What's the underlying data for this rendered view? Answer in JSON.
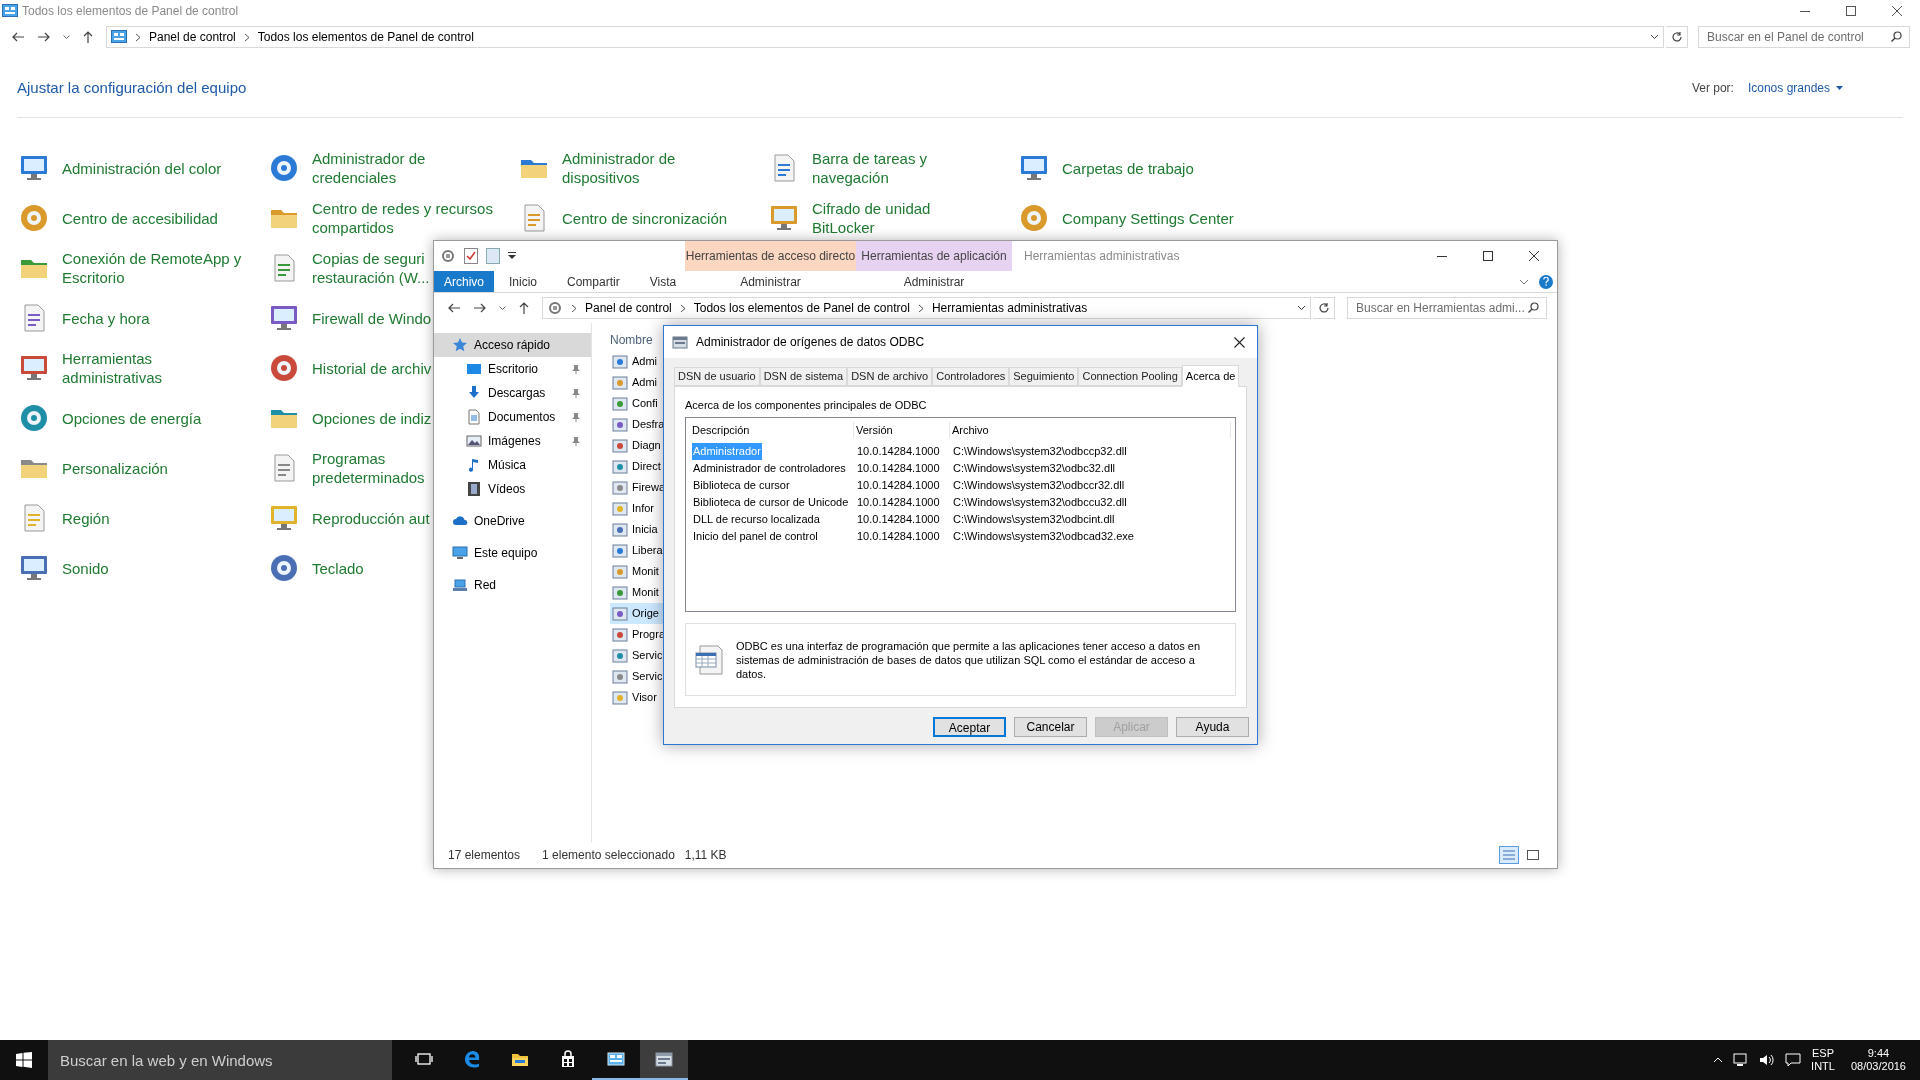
{
  "control_panel": {
    "title": "Todos los elementos de Panel de control",
    "breadcrumb": [
      "Panel de control",
      "Todos los elementos de Panel de control"
    ],
    "search": {
      "placeholder": "Buscar en el Panel de control"
    },
    "heading": "Ajustar la configuración del equipo",
    "view_by": {
      "label": "Ver por:",
      "value": "Iconos grandes"
    },
    "columns": [
      [
        {
          "lines": [
            "Administración del color"
          ]
        },
        {
          "lines": [
            "Centro de accesibilidad"
          ]
        },
        {
          "lines": [
            "Conexión de RemoteApp y",
            "Escritorio"
          ]
        },
        {
          "lines": [
            "Fecha y hora"
          ]
        },
        {
          "lines": [
            "Herramientas",
            "administrativas"
          ]
        },
        {
          "lines": [
            "Opciones de energía"
          ]
        },
        {
          "lines": [
            "Personalización"
          ]
        },
        {
          "lines": [
            "Región"
          ]
        },
        {
          "lines": [
            "Sonido"
          ]
        }
      ],
      [
        {
          "lines": [
            "Administrador de",
            "credenciales"
          ]
        },
        {
          "lines": [
            "Centro de redes y recursos",
            "compartidos"
          ]
        },
        {
          "lines": [
            "Copias de seguri",
            "restauración (W..."
          ]
        },
        {
          "lines": [
            "Firewall de Windo"
          ]
        },
        {
          "lines": [
            "Historial de archiv"
          ]
        },
        {
          "lines": [
            "Opciones de indiz"
          ]
        },
        {
          "lines": [
            "Programas",
            "predeterminados"
          ]
        },
        {
          "lines": [
            "Reproducción aut"
          ]
        },
        {
          "lines": [
            "Teclado"
          ]
        }
      ],
      [
        {
          "lines": [
            "Administrador de",
            "dispositivos"
          ]
        },
        {
          "lines": [
            "Centro de sincronización"
          ]
        }
      ],
      [
        {
          "lines": [
            "Barra de tareas y",
            "navegación"
          ]
        },
        {
          "lines": [
            "Cifrado de unidad",
            "BitLocker"
          ]
        }
      ],
      [
        {
          "lines": [
            "Carpetas de trabajo"
          ]
        },
        {
          "lines": [
            "Company Settings Center"
          ]
        }
      ]
    ]
  },
  "explorer": {
    "contextual_tabs": [
      {
        "label": "Herramientas de acceso directo",
        "sub": "Administrar",
        "color": "#fbd6c0"
      },
      {
        "label": "Herramientas de aplicación",
        "sub": "Administrar",
        "color": "#e8d2f2"
      }
    ],
    "title": "Herramientas administrativas",
    "file_tab": "Archivo",
    "ribbon_tabs": [
      "Inicio",
      "Compartir",
      "Vista"
    ],
    "breadcrumb": [
      "Panel de control",
      "Todos los elementos de Panel de control",
      "Herramientas administrativas"
    ],
    "search": {
      "placeholder": "Buscar en Herramientas admi..."
    },
    "nav": [
      {
        "label": "Acceso rápido",
        "selected": true,
        "children": [
          {
            "label": "Escritorio",
            "pinned": true
          },
          {
            "label": "Descargas",
            "pinned": true
          },
          {
            "label": "Documentos",
            "pinned": true
          },
          {
            "label": "Imágenes",
            "pinned": true
          },
          {
            "label": "Música",
            "pinned": false
          },
          {
            "label": "Vídeos",
            "pinned": false
          }
        ]
      },
      {
        "label": "OneDrive",
        "selected": false
      },
      {
        "label": "Este equipo",
        "selected": false
      },
      {
        "label": "Red",
        "selected": false
      }
    ],
    "column_header": "Nombre",
    "files": [
      {
        "name": "Admi",
        "selected": false
      },
      {
        "name": "Admi",
        "selected": false
      },
      {
        "name": "Confi",
        "selected": false
      },
      {
        "name": "Desfra",
        "selected": false
      },
      {
        "name": "Diagn",
        "selected": false
      },
      {
        "name": "Direct",
        "selected": false
      },
      {
        "name": "Firewa",
        "selected": false
      },
      {
        "name": "Infor",
        "selected": false
      },
      {
        "name": "Inicia",
        "selected": false
      },
      {
        "name": "Libera",
        "selected": false
      },
      {
        "name": "Monit",
        "selected": false
      },
      {
        "name": "Monit",
        "selected": false
      },
      {
        "name": "Orige",
        "selected": true
      },
      {
        "name": "Progra",
        "selected": false
      },
      {
        "name": "Servic",
        "selected": false
      },
      {
        "name": "Servic",
        "selected": false
      },
      {
        "name": "Visor",
        "selected": false
      }
    ],
    "status": [
      "17 elementos",
      "1 elemento seleccionado",
      "1,11 KB"
    ]
  },
  "dialog": {
    "title": "Administrador de orígenes de datos ODBC",
    "tabs": [
      {
        "label": "DSN de usuario",
        "selected": false
      },
      {
        "label": "DSN de sistema",
        "selected": false
      },
      {
        "label": "DSN de archivo",
        "selected": false
      },
      {
        "label": "Controladores",
        "selected": false
      },
      {
        "label": "Seguimiento",
        "selected": false
      },
      {
        "label": "Connection Pooling",
        "selected": false
      },
      {
        "label": "Acerca de",
        "selected": true
      }
    ],
    "section_label": "Acerca de los componentes principales de ODBC",
    "table": {
      "columns": [
        "Descripción",
        "Versión",
        "Archivo"
      ],
      "rows": [
        {
          "cells": [
            "Administrador",
            "10.0.14284.1000",
            "C:\\Windows\\system32\\odbccp32.dll"
          ],
          "selected": true
        },
        {
          "cells": [
            "Administrador de controladores",
            "10.0.14284.1000",
            "C:\\Windows\\system32\\odbc32.dll"
          ],
          "selected": false
        },
        {
          "cells": [
            "Biblioteca de cursor",
            "10.0.14284.1000",
            "C:\\Windows\\system32\\odbccr32.dll"
          ],
          "selected": false
        },
        {
          "cells": [
            "Biblioteca de cursor de Unicode",
            "10.0.14284.1000",
            "C:\\Windows\\system32\\odbccu32.dll"
          ],
          "selected": false
        },
        {
          "cells": [
            "DLL de recurso localizada",
            "10.0.14284.1000",
            "C:\\Windows\\system32\\odbcint.dll"
          ],
          "selected": false
        },
        {
          "cells": [
            "Inicio del panel de control",
            "10.0.14284.1000",
            "C:\\Windows\\system32\\odbcad32.exe"
          ],
          "selected": false
        }
      ]
    },
    "info": "ODBC es una interfaz de programación que permite a las aplicaciones tener acceso a datos en sistemas de administración de bases de datos que utilizan SQL como el estándar de acceso a datos.",
    "buttons": [
      {
        "label": "Aceptar",
        "default": true,
        "disabled": false
      },
      {
        "label": "Cancelar",
        "default": false,
        "disabled": false
      },
      {
        "label": "Aplicar",
        "default": false,
        "disabled": true
      },
      {
        "label": "Ayuda",
        "default": false,
        "disabled": false
      }
    ]
  },
  "taskbar": {
    "search": {
      "placeholder": "Buscar en la web y en Windows"
    },
    "apps": [
      {
        "open": false,
        "focused": false
      },
      {
        "open": false,
        "focused": false
      },
      {
        "open": false,
        "focused": false
      },
      {
        "open": false,
        "focused": false
      },
      {
        "open": true,
        "focused": false
      },
      {
        "open": true,
        "focused": true
      }
    ],
    "language": [
      "ESP",
      "INTL"
    ],
    "time": "9:44",
    "date": "08/03/2016"
  }
}
